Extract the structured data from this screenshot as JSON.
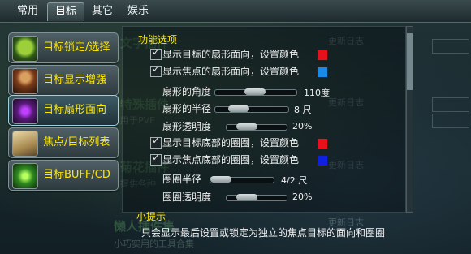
{
  "tabs": [
    {
      "label": "常用"
    },
    {
      "label": "目标"
    },
    {
      "label": "其它"
    },
    {
      "label": "娱乐"
    }
  ],
  "active_tab": "目标",
  "nav": [
    {
      "label": "目标锁定/选择",
      "icon": "green-face-icon"
    },
    {
      "label": "目标显示增强",
      "icon": "warrior-icon"
    },
    {
      "label": "目标扇形面向",
      "icon": "purple-figure-icon"
    },
    {
      "label": "焦点/目标列表",
      "icon": "scroll-icon"
    },
    {
      "label": "目标BUFF/CD",
      "icon": "green-burst-icon"
    }
  ],
  "active_nav": "目标扇形面向",
  "panel": {
    "title": "功能选项",
    "options": {
      "show_target_sector": {
        "label": "显示目标的扇形面向，设置颜色",
        "checked": true,
        "color": "#e8101a"
      },
      "show_focus_sector": {
        "label": "显示焦点的扇形面向，设置颜色",
        "checked": true,
        "color": "#1a8ae8"
      },
      "sector_angle": {
        "label": "扇形的角度",
        "value": "110度",
        "level": 0.3
      },
      "sector_radius": {
        "label": "扇形的半径",
        "value": "8 尺",
        "level": 0.15
      },
      "sector_opacity": {
        "label": "扇形透明度",
        "value": "20%",
        "level": 0.2
      },
      "show_target_circle": {
        "label": "显示目标底部的圈圈，设置颜色",
        "checked": true,
        "color": "#e8101a"
      },
      "show_focus_circle": {
        "label": "显示焦点底部的圈圈，设置颜色",
        "checked": true,
        "color": "#1020e0"
      },
      "circle_radius": {
        "label": "圈圈半径",
        "value": "4/2 尺",
        "level": 0.0
      },
      "circle_opacity": {
        "label": "圈圈透明度",
        "value": "20%",
        "level": 0.2
      }
    }
  },
  "hint": {
    "title": "小提示",
    "text": "只会显示最后设置或锁定为独立的焦点目标的面向和圈圈"
  },
  "background": {
    "update_log": "更新日志",
    "faded_title": "懒人插件集",
    "faded_sub": "小巧实用的工具合集"
  }
}
